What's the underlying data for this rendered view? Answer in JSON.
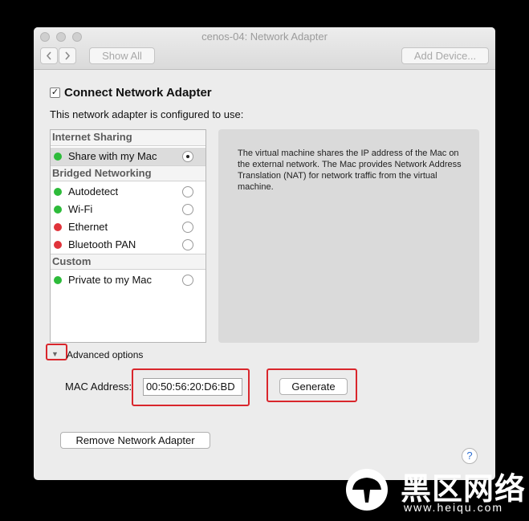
{
  "window": {
    "title": "cenos-04: Network Adapter",
    "back_icon": "chevron-left-icon",
    "forward_icon": "chevron-right-icon",
    "show_all_label": "Show All",
    "add_device_label": "Add Device..."
  },
  "connect": {
    "label": "Connect Network Adapter",
    "checked": true,
    "check_glyph": "✓"
  },
  "configured_text": "This network adapter is configured to use:",
  "list": {
    "groups": [
      {
        "header": "Internet Sharing",
        "items": [
          {
            "label": "Share with my Mac",
            "status_color": "#2dbb3a",
            "selected": true
          }
        ]
      },
      {
        "header": "Bridged Networking",
        "items": [
          {
            "label": "Autodetect",
            "status_color": "#2dbb3a",
            "selected": false
          },
          {
            "label": "Wi-Fi",
            "status_color": "#2dbb3a",
            "selected": false
          },
          {
            "label": "Ethernet",
            "status_color": "#e0333a",
            "selected": false
          },
          {
            "label": "Bluetooth PAN",
            "status_color": "#e0333a",
            "selected": false
          }
        ]
      },
      {
        "header": "Custom",
        "items": [
          {
            "label": "Private to my Mac",
            "status_color": "#2dbb3a",
            "selected": false
          }
        ]
      }
    ]
  },
  "description": "The virtual machine shares the IP address of the Mac on the external network. The Mac provides Network Address Translation (NAT) for network traffic from the virtual machine.",
  "advanced": {
    "toggle_glyph": "▼",
    "label": "Advanced options",
    "mac_label": "MAC Address:",
    "mac_value": "00:50:56:20:D6:BD",
    "generate_label": "Generate"
  },
  "remove_label": "Remove Network Adapter",
  "help_glyph": "?",
  "highlight_color": "#d9262c",
  "watermark": {
    "text": "黑区网络",
    "url": "www.heiqu.com"
  }
}
